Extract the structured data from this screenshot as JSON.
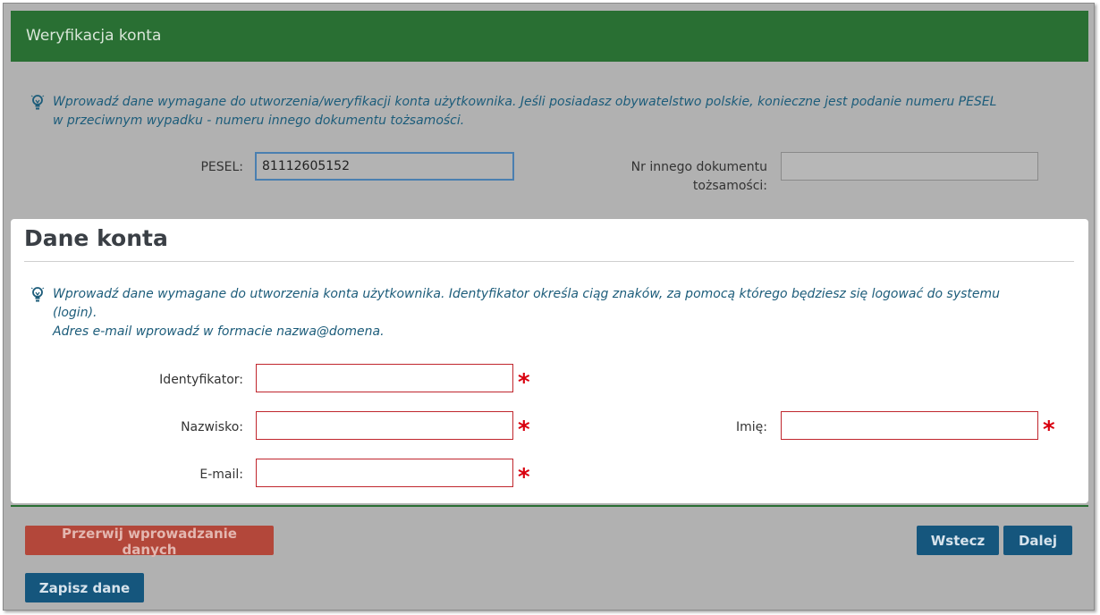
{
  "header": {
    "title": "Weryfikacja konta"
  },
  "verification": {
    "info_lines": [
      "Wprowadź dane wymagane do utworzenia/weryfikacji konta użytkownika. Jeśli posiadasz obywatelstwo polskie, konieczne jest podanie numeru PESEL",
      "w przeciwnym wypadku - numeru innego dokumentu tożsamości."
    ],
    "pesel": {
      "label": "PESEL:",
      "value": "81112605152"
    },
    "other_doc": {
      "label_line1": "Nr innego dokumentu",
      "label_line2": "tożsamości:",
      "value": ""
    }
  },
  "account": {
    "title": "Dane konta",
    "info_lines": [
      "Wprowadź dane wymagane do utworzenia konta użytkownika. Identyfikator określa ciąg znaków, za pomocą którego będziesz się logować do systemu",
      "(login).",
      "Adres e-mail wprowadź w formacie nazwa@domena."
    ],
    "login": {
      "label": "Identyfikator:",
      "value": ""
    },
    "surname": {
      "label": "Nazwisko:",
      "value": ""
    },
    "firstname": {
      "label": "Imię:",
      "value": ""
    },
    "email": {
      "label": "E-mail:",
      "value": ""
    },
    "required_mark": "*"
  },
  "buttons": {
    "abort": "Przerwij wprowadzanie danych",
    "back": "Wstecz",
    "next": "Dalej",
    "save": "Zapisz dane"
  },
  "colors": {
    "header_bg": "#296f33",
    "overlay_bg": "#b1b1b1",
    "info_text": "#1c5c7a",
    "required": "#d9000f",
    "primary_button": "#15567d",
    "danger_button": "#b3473a"
  },
  "icons": {
    "info": "lightbulb-icon"
  }
}
